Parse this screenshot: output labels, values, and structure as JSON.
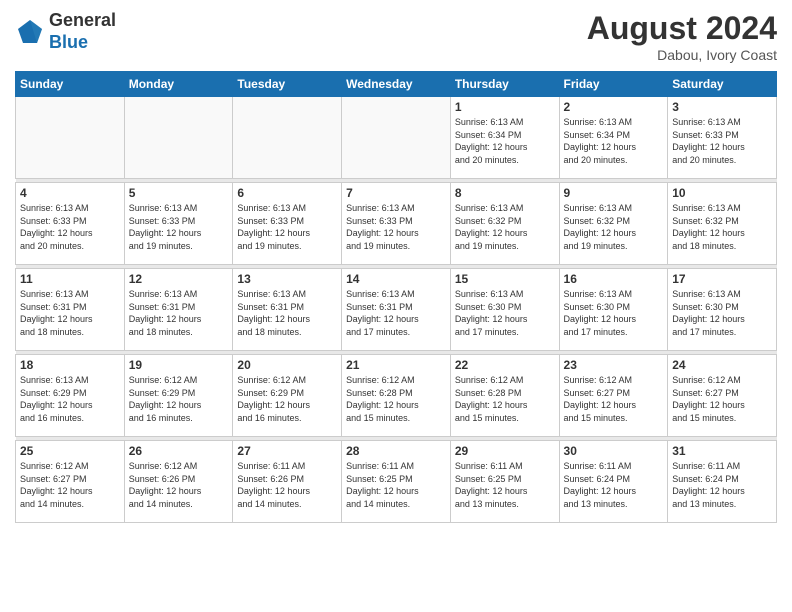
{
  "logo": {
    "text_general": "General",
    "text_blue": "Blue"
  },
  "header": {
    "title": "August 2024",
    "location": "Dabou, Ivory Coast"
  },
  "weekdays": [
    "Sunday",
    "Monday",
    "Tuesday",
    "Wednesday",
    "Thursday",
    "Friday",
    "Saturday"
  ],
  "weeks": [
    [
      {
        "day": "",
        "info": ""
      },
      {
        "day": "",
        "info": ""
      },
      {
        "day": "",
        "info": ""
      },
      {
        "day": "",
        "info": ""
      },
      {
        "day": "1",
        "info": "Sunrise: 6:13 AM\nSunset: 6:34 PM\nDaylight: 12 hours\nand 20 minutes."
      },
      {
        "day": "2",
        "info": "Sunrise: 6:13 AM\nSunset: 6:34 PM\nDaylight: 12 hours\nand 20 minutes."
      },
      {
        "day": "3",
        "info": "Sunrise: 6:13 AM\nSunset: 6:33 PM\nDaylight: 12 hours\nand 20 minutes."
      }
    ],
    [
      {
        "day": "4",
        "info": "Sunrise: 6:13 AM\nSunset: 6:33 PM\nDaylight: 12 hours\nand 20 minutes."
      },
      {
        "day": "5",
        "info": "Sunrise: 6:13 AM\nSunset: 6:33 PM\nDaylight: 12 hours\nand 19 minutes."
      },
      {
        "day": "6",
        "info": "Sunrise: 6:13 AM\nSunset: 6:33 PM\nDaylight: 12 hours\nand 19 minutes."
      },
      {
        "day": "7",
        "info": "Sunrise: 6:13 AM\nSunset: 6:33 PM\nDaylight: 12 hours\nand 19 minutes."
      },
      {
        "day": "8",
        "info": "Sunrise: 6:13 AM\nSunset: 6:32 PM\nDaylight: 12 hours\nand 19 minutes."
      },
      {
        "day": "9",
        "info": "Sunrise: 6:13 AM\nSunset: 6:32 PM\nDaylight: 12 hours\nand 19 minutes."
      },
      {
        "day": "10",
        "info": "Sunrise: 6:13 AM\nSunset: 6:32 PM\nDaylight: 12 hours\nand 18 minutes."
      }
    ],
    [
      {
        "day": "11",
        "info": "Sunrise: 6:13 AM\nSunset: 6:31 PM\nDaylight: 12 hours\nand 18 minutes."
      },
      {
        "day": "12",
        "info": "Sunrise: 6:13 AM\nSunset: 6:31 PM\nDaylight: 12 hours\nand 18 minutes."
      },
      {
        "day": "13",
        "info": "Sunrise: 6:13 AM\nSunset: 6:31 PM\nDaylight: 12 hours\nand 18 minutes."
      },
      {
        "day": "14",
        "info": "Sunrise: 6:13 AM\nSunset: 6:31 PM\nDaylight: 12 hours\nand 17 minutes."
      },
      {
        "day": "15",
        "info": "Sunrise: 6:13 AM\nSunset: 6:30 PM\nDaylight: 12 hours\nand 17 minutes."
      },
      {
        "day": "16",
        "info": "Sunrise: 6:13 AM\nSunset: 6:30 PM\nDaylight: 12 hours\nand 17 minutes."
      },
      {
        "day": "17",
        "info": "Sunrise: 6:13 AM\nSunset: 6:30 PM\nDaylight: 12 hours\nand 17 minutes."
      }
    ],
    [
      {
        "day": "18",
        "info": "Sunrise: 6:13 AM\nSunset: 6:29 PM\nDaylight: 12 hours\nand 16 minutes."
      },
      {
        "day": "19",
        "info": "Sunrise: 6:12 AM\nSunset: 6:29 PM\nDaylight: 12 hours\nand 16 minutes."
      },
      {
        "day": "20",
        "info": "Sunrise: 6:12 AM\nSunset: 6:29 PM\nDaylight: 12 hours\nand 16 minutes."
      },
      {
        "day": "21",
        "info": "Sunrise: 6:12 AM\nSunset: 6:28 PM\nDaylight: 12 hours\nand 15 minutes."
      },
      {
        "day": "22",
        "info": "Sunrise: 6:12 AM\nSunset: 6:28 PM\nDaylight: 12 hours\nand 15 minutes."
      },
      {
        "day": "23",
        "info": "Sunrise: 6:12 AM\nSunset: 6:27 PM\nDaylight: 12 hours\nand 15 minutes."
      },
      {
        "day": "24",
        "info": "Sunrise: 6:12 AM\nSunset: 6:27 PM\nDaylight: 12 hours\nand 15 minutes."
      }
    ],
    [
      {
        "day": "25",
        "info": "Sunrise: 6:12 AM\nSunset: 6:27 PM\nDaylight: 12 hours\nand 14 minutes."
      },
      {
        "day": "26",
        "info": "Sunrise: 6:12 AM\nSunset: 6:26 PM\nDaylight: 12 hours\nand 14 minutes."
      },
      {
        "day": "27",
        "info": "Sunrise: 6:11 AM\nSunset: 6:26 PM\nDaylight: 12 hours\nand 14 minutes."
      },
      {
        "day": "28",
        "info": "Sunrise: 6:11 AM\nSunset: 6:25 PM\nDaylight: 12 hours\nand 14 minutes."
      },
      {
        "day": "29",
        "info": "Sunrise: 6:11 AM\nSunset: 6:25 PM\nDaylight: 12 hours\nand 13 minutes."
      },
      {
        "day": "30",
        "info": "Sunrise: 6:11 AM\nSunset: 6:24 PM\nDaylight: 12 hours\nand 13 minutes."
      },
      {
        "day": "31",
        "info": "Sunrise: 6:11 AM\nSunset: 6:24 PM\nDaylight: 12 hours\nand 13 minutes."
      }
    ]
  ]
}
